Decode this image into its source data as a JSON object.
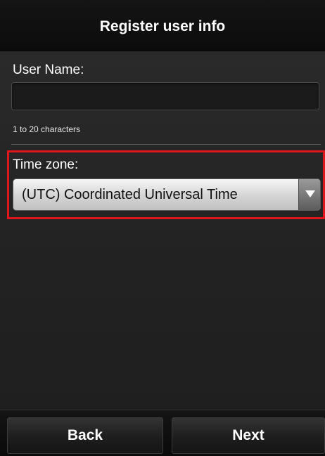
{
  "header": {
    "title": "Register user info"
  },
  "form": {
    "user_name": {
      "label": "User Name:",
      "value": "",
      "hint": "1 to 20 characters"
    },
    "time_zone": {
      "label": "Time zone:",
      "selected": "(UTC) Coordinated Universal Time"
    }
  },
  "footer": {
    "back_label": "Back",
    "next_label": "Next"
  },
  "colors": {
    "highlight_border": "#e0161d",
    "background": "#1f1f1f",
    "header_background": "#0f0f0f"
  },
  "icons": {
    "dropdown": "chevron-down-icon"
  }
}
